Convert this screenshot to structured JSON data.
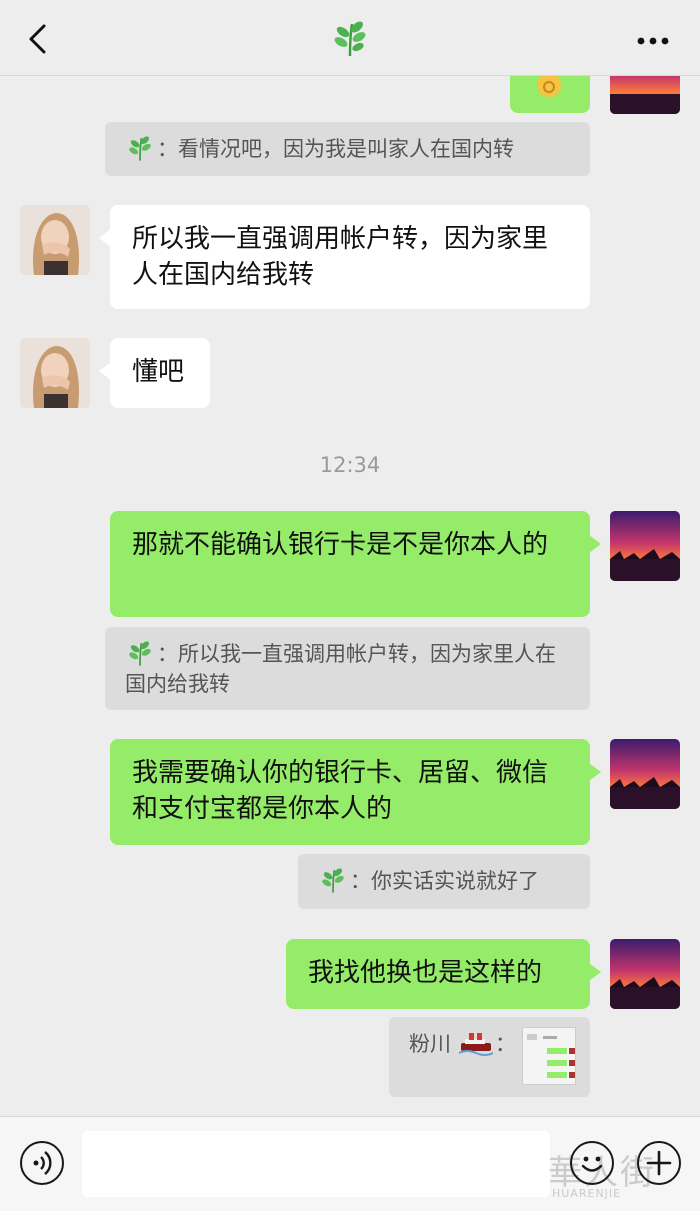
{
  "header": {
    "back_icon": "chevron-left-icon",
    "title_icon": "leaf-icon",
    "more_label": "•••"
  },
  "messages": {
    "m1_quote": "：看情况吧，因为我是叫家人在国内转",
    "m2_text": "所以我一直强调用帐户转，因为家里人在国内给我转",
    "m3_text": "懂吧",
    "time": "12:34",
    "m4_text": "那就不能确认银行卡是不是你本人的",
    "m4_quote": "：所以我一直强调用帐户转，因为家里人在国内给我转",
    "m5_text": "我需要确认你的银行卡、居留、微信和支付宝都是你本人的",
    "m5_quote": "：你实话实说就好了",
    "m6_text": "我找他换也是这样的",
    "m6_quote_name": "粉川",
    "m6_quote_sep": "："
  },
  "watermark": {
    "main": "華人街",
    "sub": "HUARENJIE"
  },
  "colors": {
    "background": "#ededed",
    "green_bubble": "#95ec69",
    "white_bubble": "#ffffff",
    "quote_bg": "#dcdcdc"
  }
}
